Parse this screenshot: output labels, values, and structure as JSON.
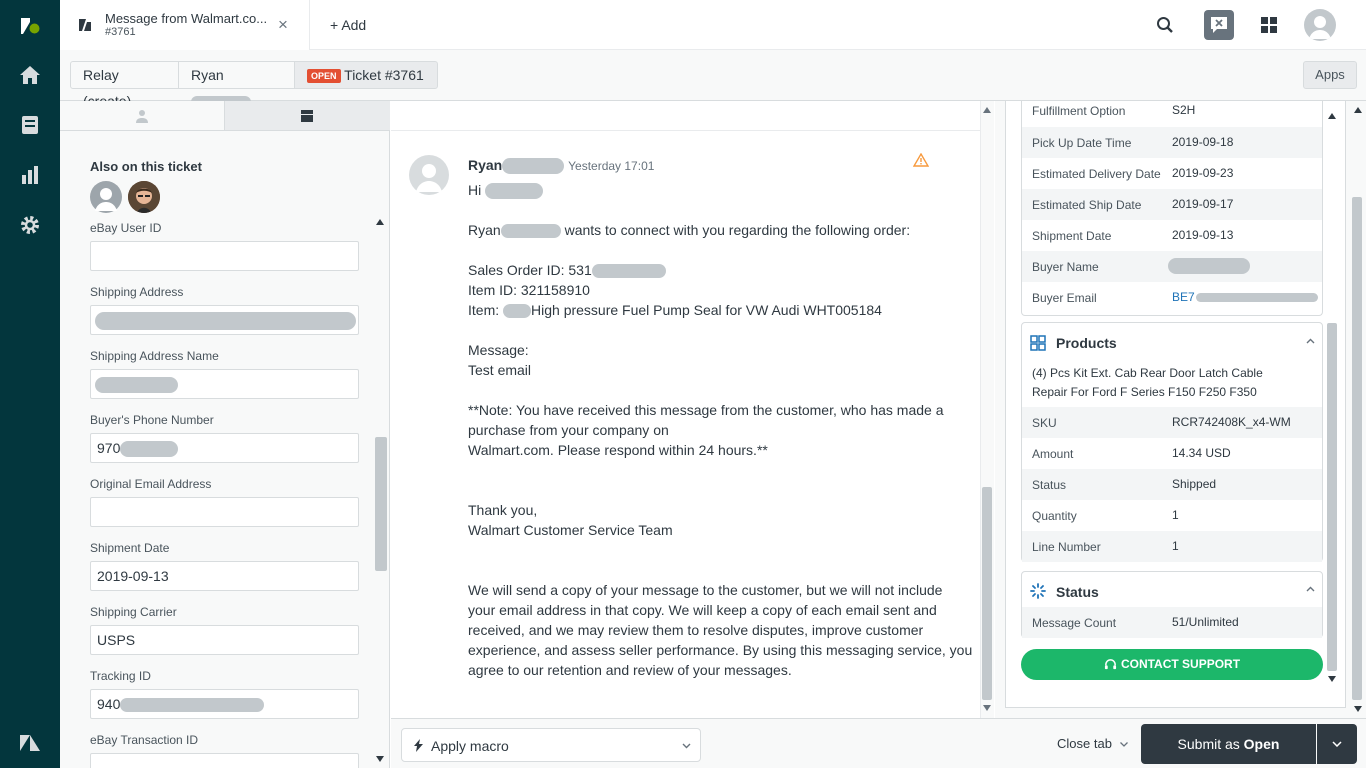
{
  "colors": {
    "rail": "#03363d",
    "open_badge": "#e34f32",
    "submit": "#2f3941",
    "contact": "#1cb76a",
    "link": "#1f73b7",
    "warn": "#f79a3e"
  },
  "tab": {
    "title": "Message from Walmart.co...",
    "subtitle": "#3761",
    "close_icon": "×"
  },
  "add_tab": {
    "plus": "+",
    "label": "Add"
  },
  "breadcrumb": {
    "relay": "Relay (create)",
    "requester": "Ryan",
    "badge": "OPEN",
    "ticket": "Ticket #3761"
  },
  "apps_label": "Apps",
  "left": {
    "also_on_ticket": "Also on this ticket",
    "fields": [
      {
        "label": "eBay User ID",
        "value": ""
      },
      {
        "label": "Shipping Address",
        "value": ""
      },
      {
        "label": "Shipping Address Name",
        "value": ""
      },
      {
        "label": "Buyer's Phone Number",
        "value": "970"
      },
      {
        "label": "Original Email Address",
        "value": ""
      },
      {
        "label": "Shipment Date",
        "value": "2019-09-13"
      },
      {
        "label": "Shipping Carrier",
        "value": "USPS"
      },
      {
        "label": "Tracking ID",
        "value": "940"
      },
      {
        "label": "eBay Transaction ID",
        "value": ""
      }
    ]
  },
  "message": {
    "sender": "Ryan",
    "time": "Yesterday 17:01",
    "greeting": "Hi",
    "l1_prefix": "Ryan",
    "l1_suffix": "wants to connect with you regarding the following order:",
    "sales_order": "Sales Order ID:  531",
    "item_id": "Item ID:  321158910",
    "item_prefix": "Item:",
    "item_name": "High pressure Fuel Pump Seal for VW Audi WHT005184",
    "message_label": "Message:",
    "message_body": "Test email",
    "note1": "**Note: You have received this message from the customer, who has made a",
    "note2": "purchase from your company on",
    "note3": "Walmart.com. Please respond within 24 hours.**",
    "thanks": "Thank you,",
    "team": "Walmart Customer Service Team",
    "disc1": "We will send a copy of your message to the customer, but we will not include",
    "disc2": "your email address in that copy. We will keep a copy of each email sent and",
    "disc3": "received, and we may review them to resolve disputes, improve customer",
    "disc4": "experience, and assess seller performance. By using this messaging service, you",
    "disc5": "agree to our retention and review of your messages."
  },
  "order_card": {
    "rows": [
      {
        "k": "Fulfillment Option",
        "v": "S2H"
      },
      {
        "k": "Pick Up Date Time",
        "v": "2019-09-18"
      },
      {
        "k": "Estimated Delivery Date",
        "v": "2019-09-23"
      },
      {
        "k": "Estimated Ship Date",
        "v": "2019-09-17"
      },
      {
        "k": "Shipment Date",
        "v": "2019-09-13"
      },
      {
        "k": "Buyer Name",
        "v": ""
      },
      {
        "k": "Buyer Email",
        "v": "BE7"
      }
    ]
  },
  "products": {
    "title": "Products",
    "name1": "(4) Pcs Kit Ext. Cab Rear Door Latch Cable",
    "name2": "Repair For Ford F Series F150 F250 F350",
    "rows": [
      {
        "k": "SKU",
        "v": "RCR742408K_x4-WM"
      },
      {
        "k": "Amount",
        "v": "14.34 USD"
      },
      {
        "k": "Status",
        "v": "Shipped"
      },
      {
        "k": "Quantity",
        "v": "1"
      },
      {
        "k": "Line Number",
        "v": "1"
      }
    ]
  },
  "status_card": {
    "title": "Status",
    "k": "Message Count",
    "v": "51/Unlimited"
  },
  "contact_support": "CONTACT SUPPORT",
  "bottom": {
    "apply_macro": "Apply macro",
    "close_tab": "Close tab",
    "submit_prefix": "Submit as ",
    "submit_status": "Open"
  }
}
